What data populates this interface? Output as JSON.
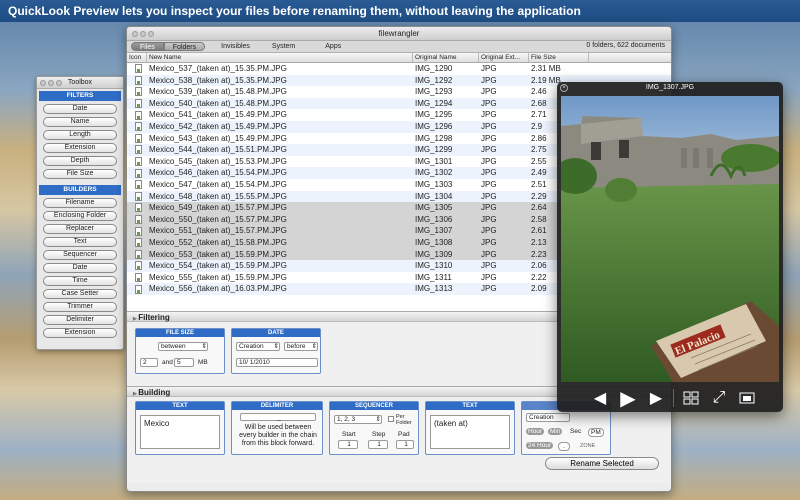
{
  "banner": {
    "text": "QuickLook Preview lets you inspect your files before renaming them, without leaving the application"
  },
  "toolbox": {
    "title": "Toolbox",
    "filters_header": "FILTERS",
    "filters": [
      "Date",
      "Name",
      "Length",
      "Extension",
      "Depth",
      "File Size"
    ],
    "builders_header": "BUILDERS",
    "builders": [
      "Filename",
      "Enclosing Folder",
      "Replacer",
      "Text",
      "Sequencer",
      "Date",
      "Time",
      "Case Setter",
      "Trimmer",
      "Delimiter",
      "Extension"
    ]
  },
  "window": {
    "title": "filewrangler",
    "segment": [
      "Files",
      "Folders"
    ],
    "tabs": [
      "Invisibles",
      "System",
      "Apps"
    ],
    "summary": "0 folders, 622 documents"
  },
  "table": {
    "columns": [
      "Icon",
      "New Name",
      "Original Name",
      "Original Ext...",
      "File Size"
    ],
    "rows": [
      {
        "new": "Mexico_537_(taken at)_15.35.PM.JPG",
        "orig": "IMG_1290",
        "ext": "JPG",
        "size": "2.31 MB",
        "sel": false
      },
      {
        "new": "Mexico_538_(taken at)_15.35.PM.JPG",
        "orig": "IMG_1292",
        "ext": "JPG",
        "size": "2.19 MB",
        "sel": false
      },
      {
        "new": "Mexico_539_(taken at)_15.48.PM.JPG",
        "orig": "IMG_1293",
        "ext": "JPG",
        "size": "2.46",
        "sel": false
      },
      {
        "new": "Mexico_540_(taken at)_15.48.PM.JPG",
        "orig": "IMG_1294",
        "ext": "JPG",
        "size": "2.68",
        "sel": false
      },
      {
        "new": "Mexico_541_(taken at)_15.49.PM.JPG",
        "orig": "IMG_1295",
        "ext": "JPG",
        "size": "2.71",
        "sel": false
      },
      {
        "new": "Mexico_542_(taken at)_15.49.PM.JPG",
        "orig": "IMG_1296",
        "ext": "JPG",
        "size": "2.9",
        "sel": false
      },
      {
        "new": "Mexico_543_(taken at)_15.49.PM.JPG",
        "orig": "IMG_1298",
        "ext": "JPG",
        "size": "2.86",
        "sel": false
      },
      {
        "new": "Mexico_544_(taken at)_15.51.PM.JPG",
        "orig": "IMG_1299",
        "ext": "JPG",
        "size": "2.75",
        "sel": false
      },
      {
        "new": "Mexico_545_(taken at)_15.53.PM.JPG",
        "orig": "IMG_1301",
        "ext": "JPG",
        "size": "2.55",
        "sel": false
      },
      {
        "new": "Mexico_546_(taken at)_15.54.PM.JPG",
        "orig": "IMG_1302",
        "ext": "JPG",
        "size": "2.49",
        "sel": false
      },
      {
        "new": "Mexico_547_(taken at)_15.54.PM.JPG",
        "orig": "IMG_1303",
        "ext": "JPG",
        "size": "2.51",
        "sel": false
      },
      {
        "new": "Mexico_548_(taken at)_15.55.PM.JPG",
        "orig": "IMG_1304",
        "ext": "JPG",
        "size": "2.29",
        "sel": false
      },
      {
        "new": "Mexico_549_(taken at)_15.57.PM.JPG",
        "orig": "IMG_1305",
        "ext": "JPG",
        "size": "2.64",
        "sel": true
      },
      {
        "new": "Mexico_550_(taken at)_15.57.PM.JPG",
        "orig": "IMG_1306",
        "ext": "JPG",
        "size": "2.58",
        "sel": true
      },
      {
        "new": "Mexico_551_(taken at)_15.57.PM.JPG",
        "orig": "IMG_1307",
        "ext": "JPG",
        "size": "2.61",
        "sel": true
      },
      {
        "new": "Mexico_552_(taken at)_15.58.PM.JPG",
        "orig": "IMG_1308",
        "ext": "JPG",
        "size": "2.13",
        "sel": true
      },
      {
        "new": "Mexico_553_(taken at)_15.59.PM.JPG",
        "orig": "IMG_1309",
        "ext": "JPG",
        "size": "2.23",
        "sel": true
      },
      {
        "new": "Mexico_554_(taken at)_15.59.PM.JPG",
        "orig": "IMG_1310",
        "ext": "JPG",
        "size": "2.06",
        "sel": false
      },
      {
        "new": "Mexico_555_(taken at)_15.59.PM.JPG",
        "orig": "IMG_1311",
        "ext": "JPG",
        "size": "2.22",
        "sel": false
      },
      {
        "new": "Mexico_556_(taken at)_16.03.PM.JPG",
        "orig": "IMG_1313",
        "ext": "JPG",
        "size": "2.09",
        "sel": false
      }
    ]
  },
  "filtering": {
    "title": "Filtering",
    "file_size": {
      "header": "FILE SIZE",
      "mode": "between",
      "low": "2",
      "and_label": "and",
      "high": "5",
      "unit": "MB"
    },
    "date": {
      "header": "DATE",
      "field": "Creation",
      "mode": "before",
      "value": "10/  1/2010"
    }
  },
  "building": {
    "title": "Building",
    "text1": {
      "header": "TEXT",
      "value": "Mexico"
    },
    "delimiter": {
      "header": "DELIMITER",
      "value": "_",
      "note": "Will be used between every builder in the chain from this block forward."
    },
    "sequencer": {
      "header": "SEQUENCER",
      "style": "1, 2, 3",
      "per_folder": "Per Folder",
      "start_label": "Start",
      "step_label": "Step",
      "pad_label": "Pad",
      "start": "1",
      "step": "1",
      "pad": "1"
    },
    "text2": {
      "header": "TEXT",
      "value": "(taken at)"
    },
    "time": {
      "field": "Creation",
      "hour": "Hour",
      "min": "Min",
      "sec": "Sec",
      "pm": "PM",
      "hour24": "24 Hour",
      "sep": ".",
      "zone": "ZONE"
    }
  },
  "actions": {
    "rename": "Rename Selected"
  },
  "preview": {
    "title": "IMG_1307.JPG",
    "sign_text": "El Palacio"
  }
}
